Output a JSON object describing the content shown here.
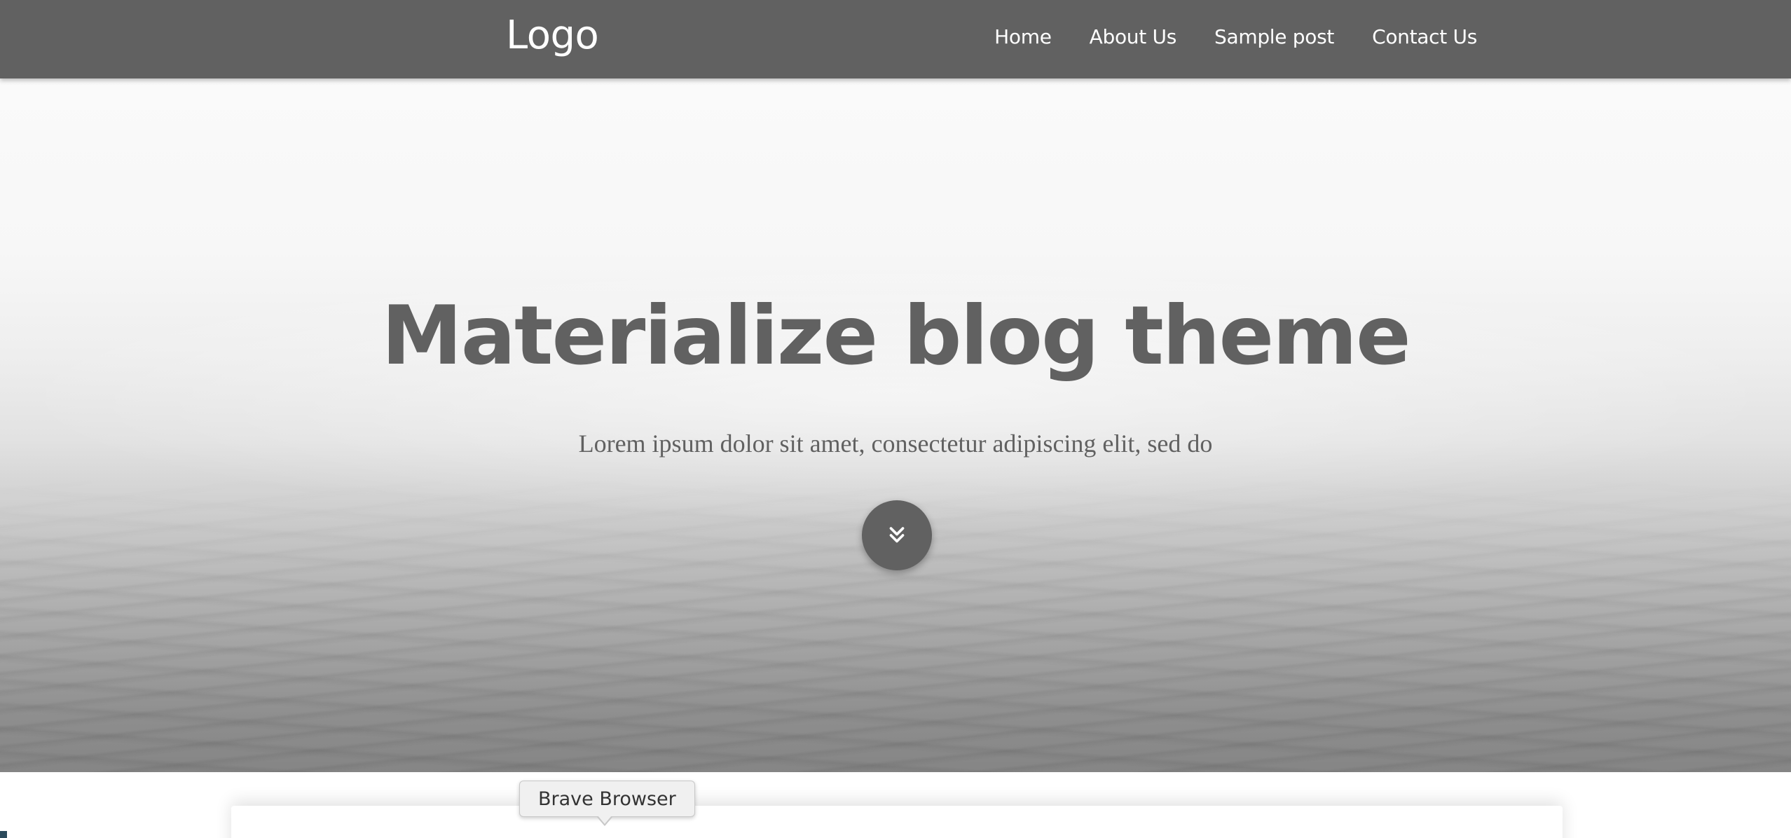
{
  "navbar": {
    "logo": "Logo",
    "links": [
      "Home",
      "About Us",
      "Sample post",
      "Contact Us"
    ]
  },
  "hero": {
    "title": "Materialize blog theme",
    "subtitle": "Lorem ipsum dolor sit amet, consectetur adipiscing elit, sed do",
    "scroll_icon": "double-chevron-down-icon"
  },
  "tooltip": {
    "text": "Brave Browser"
  },
  "colors": {
    "navbar": "#616161",
    "hero_text": "#616161",
    "button": "#616161"
  }
}
